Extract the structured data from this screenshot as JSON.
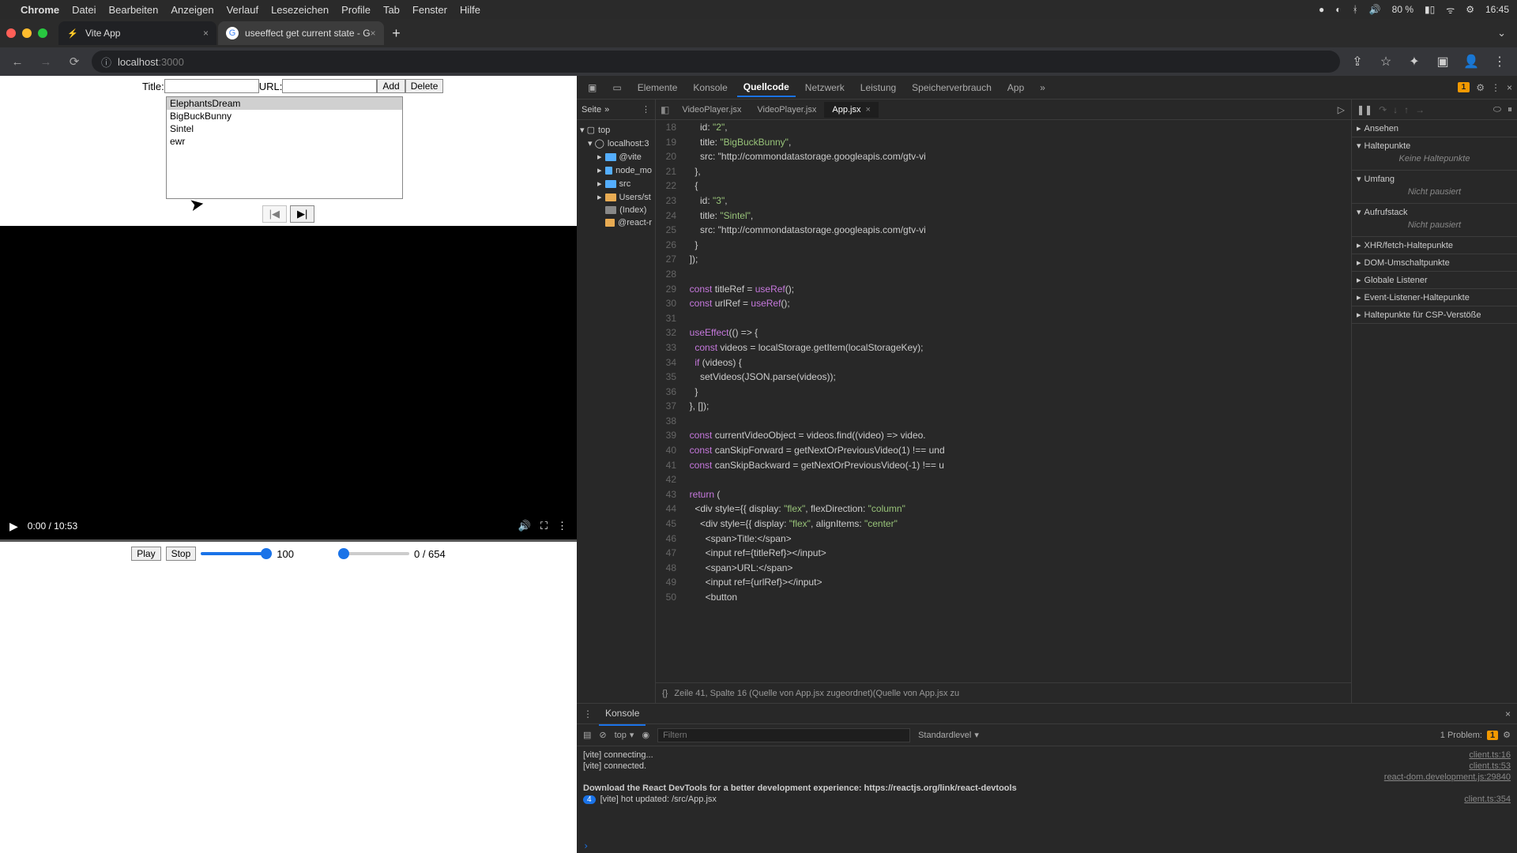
{
  "menubar": {
    "app": "Chrome",
    "items": [
      "Datei",
      "Bearbeiten",
      "Anzeigen",
      "Verlauf",
      "Lesezeichen",
      "Profile",
      "Tab",
      "Fenster",
      "Hilfe"
    ],
    "battery": "80 %",
    "time": "16:45"
  },
  "tabs": [
    {
      "title": "Vite App",
      "active": true
    },
    {
      "title": "useeffect get current state - G",
      "active": false
    }
  ],
  "url": {
    "host": "localhost",
    "port": ":3000"
  },
  "app": {
    "title_label": "Title:",
    "url_label": "URL:",
    "add": "Add",
    "delete": "Delete",
    "list": [
      "ElephantsDream",
      "BigBuckBunny",
      "Sintel",
      "ewr"
    ],
    "selected_index": 0,
    "prev": "|◀",
    "next": "▶|",
    "video_time": "0:00 / 10:53",
    "play": "Play",
    "stop": "Stop",
    "vol_value": 100,
    "vol_label": "100",
    "pos_value": 0,
    "pos_label": "0 / 654"
  },
  "devtools": {
    "tabs": [
      "Elemente",
      "Konsole",
      "Quellcode",
      "Netzwerk",
      "Leistung",
      "Speicherverbrauch",
      "App"
    ],
    "active_tab": "Quellcode",
    "warn_count": "1",
    "page_label": "Seite",
    "tree": {
      "top": "top",
      "host": "localhost:3",
      "nodes": [
        "@vite",
        "node_mo",
        "src",
        "Users/st",
        "(Index)",
        "@react-r"
      ]
    },
    "editor_tabs": [
      "VideoPlayer.jsx",
      "VideoPlayer.jsx",
      "App.jsx"
    ],
    "active_editor": 2,
    "code_lines": [
      {
        "n": 18,
        "t": "      id: \"2\","
      },
      {
        "n": 19,
        "t": "      title: \"BigBuckBunny\","
      },
      {
        "n": 20,
        "t": "      src: \"http://commondatastorage.googleapis.com/gtv-vi"
      },
      {
        "n": 21,
        "t": "    },"
      },
      {
        "n": 22,
        "t": "    {"
      },
      {
        "n": 23,
        "t": "      id: \"3\","
      },
      {
        "n": 24,
        "t": "      title: \"Sintel\","
      },
      {
        "n": 25,
        "t": "      src: \"http://commondatastorage.googleapis.com/gtv-vi"
      },
      {
        "n": 26,
        "t": "    }"
      },
      {
        "n": 27,
        "t": "  ]);"
      },
      {
        "n": 28,
        "t": ""
      },
      {
        "n": 29,
        "t": "  const titleRef = useRef();"
      },
      {
        "n": 30,
        "t": "  const urlRef = useRef();"
      },
      {
        "n": 31,
        "t": ""
      },
      {
        "n": 32,
        "t": "  useEffect(() => {"
      },
      {
        "n": 33,
        "t": "    const videos = localStorage.getItem(localStorageKey);"
      },
      {
        "n": 34,
        "t": "    if (videos) {"
      },
      {
        "n": 35,
        "t": "      setVideos(JSON.parse(videos));"
      },
      {
        "n": 36,
        "t": "    }"
      },
      {
        "n": 37,
        "t": "  }, []);"
      },
      {
        "n": 38,
        "t": ""
      },
      {
        "n": 39,
        "t": "  const currentVideoObject = videos.find((video) => video."
      },
      {
        "n": 40,
        "t": "  const canSkipForward = getNextOrPreviousVideo(1) !== und"
      },
      {
        "n": 41,
        "t": "  const canSkipBackward = getNextOrPreviousVideo(-1) !== u"
      },
      {
        "n": 42,
        "t": ""
      },
      {
        "n": 43,
        "t": "  return ("
      },
      {
        "n": 44,
        "t": "    <div style={{ display: \"flex\", flexDirection: \"column\""
      },
      {
        "n": 45,
        "t": "      <div style={{ display: \"flex\", alignItems: \"center\""
      },
      {
        "n": 46,
        "t": "        <span>Title:</span>"
      },
      {
        "n": 47,
        "t": "        <input ref={titleRef}></input>"
      },
      {
        "n": 48,
        "t": "        <span>URL:</span>"
      },
      {
        "n": 49,
        "t": "        <input ref={urlRef}></input>"
      },
      {
        "n": 50,
        "t": "        <button"
      }
    ],
    "status": "Zeile 41, Spalte 16 (Quelle von App.jsx zugeordnet)(Quelle von App.jsx zu",
    "right_sections": {
      "watch": "Ansehen",
      "breakpoints": "Haltepunkte",
      "breakpoints_empty": "Keine Haltepunkte",
      "scope": "Umfang",
      "scope_empty": "Nicht pausiert",
      "callstack": "Aufrufstack",
      "callstack_empty": "Nicht pausiert",
      "xhr": "XHR/fetch-Haltepunkte",
      "dom": "DOM-Umschaltpunkte",
      "global": "Globale Listener",
      "event": "Event-Listener-Haltepunkte",
      "csp": "Haltepunkte für CSP-Verstöße"
    }
  },
  "console": {
    "title": "Konsole",
    "top": "top",
    "filter_placeholder": "Filtern",
    "level": "Standardlevel",
    "problems_label": "1 Problem:",
    "problems_count": "1",
    "messages": [
      {
        "text": "[vite] connecting...",
        "src": "client.ts:16"
      },
      {
        "text": "[vite] connected.",
        "src": "client.ts:53"
      },
      {
        "text": "",
        "src": "react-dom.development.js:29840"
      },
      {
        "text": "Download the React DevTools for a better development experience: https://reactjs.org/link/react-devtools",
        "src": "",
        "bold": true
      },
      {
        "text": "[vite] hot updated: /src/App.jsx",
        "src": "client.ts:354",
        "count": "4"
      }
    ]
  }
}
